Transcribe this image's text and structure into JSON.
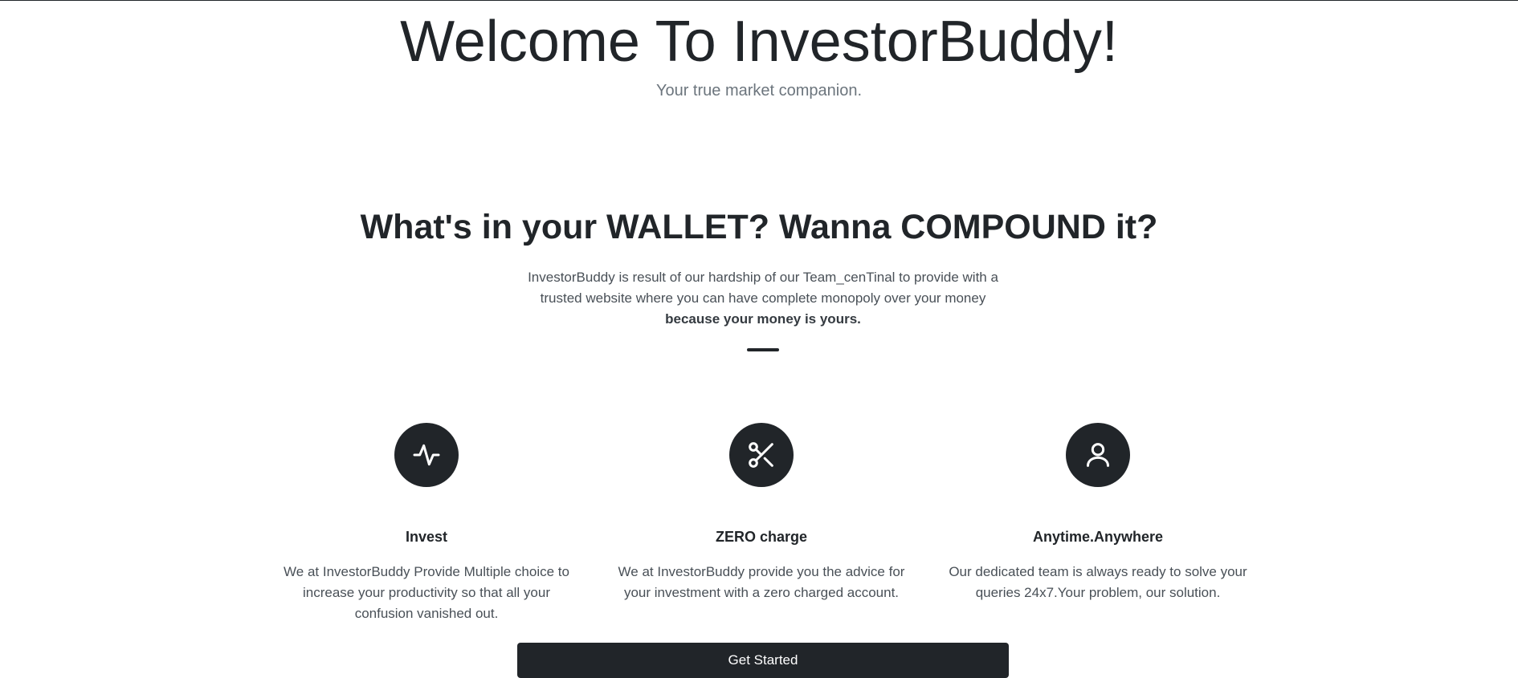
{
  "hero": {
    "title": "Welcome To InvestorBuddy!",
    "subtitle": "Your true market companion."
  },
  "about": {
    "heading": "What's in your WALLET? Wanna COMPOUND it?",
    "text": "InvestorBuddy is result of our hardship of our Team_cenTinal to provide with a trusted website where you can have complete monopoly over your money",
    "emphasis": "because your money is yours."
  },
  "features": [
    {
      "icon": "activity-icon",
      "title": "Invest",
      "text": "We at InvestorBuddy Provide Multiple choice to increase your productivity so that all your confusion vanished out."
    },
    {
      "icon": "scissors-icon",
      "title": "ZERO charge",
      "text": "We at InvestorBuddy provide you the advice for your investment with a zero charged account."
    },
    {
      "icon": "user-icon",
      "title": "Anytime.Anywhere",
      "text": "Our dedicated team is always ready to solve your queries 24x7.Your problem, our solution."
    }
  ],
  "cta": {
    "label": "Get Started"
  },
  "colors": {
    "primary_dark": "#212529",
    "text_muted": "#6c757d",
    "body_text": "#495057",
    "background": "#ffffff"
  }
}
